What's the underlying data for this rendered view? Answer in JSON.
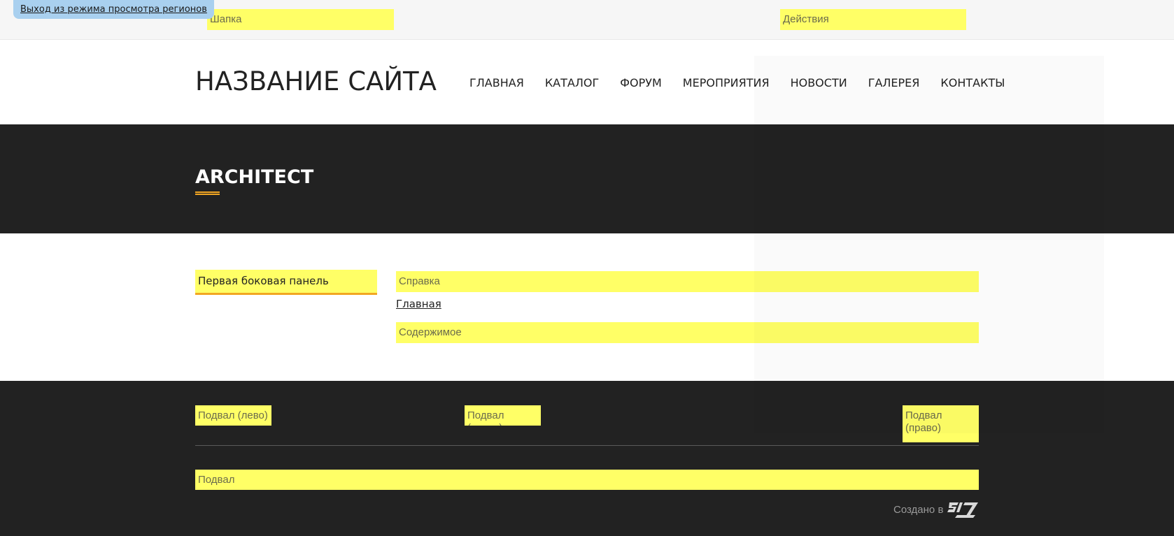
{
  "exit_demo": {
    "label": "Выход из режима просмотра регионов"
  },
  "regions": {
    "header": "Шапка",
    "actions": "Действия",
    "help": "Справка",
    "content": "Содержимое",
    "footer_left": "Подвал (лево)",
    "footer_center": "Подвал (центр)",
    "footer_right": "Подвал (право)",
    "footer": "Подвал"
  },
  "header": {
    "site_name": "НАЗВАНИЕ САЙТА",
    "nav": [
      "ГЛАВНАЯ",
      "КАТАЛОГ",
      "ФОРУМ",
      "МЕРОПРИЯТИЯ",
      "НОВОСТИ",
      "ГАЛЕРЕЯ",
      "КОНТАКТЫ"
    ]
  },
  "title_band": {
    "title": "ARCHITECT"
  },
  "main": {
    "sidebar_title": "Первая боковая панель",
    "breadcrumb_home": "Главная"
  },
  "footer": {
    "credits_text": "Создано в",
    "logo_text": "SL7"
  },
  "colors": {
    "region_highlight": "#ffff66",
    "accent": "#f2a623",
    "dark_band": "#222222",
    "exit_demo_bg": "#a9d0ef"
  },
  "icons": {
    "logo": "sl7-logo-icon"
  }
}
